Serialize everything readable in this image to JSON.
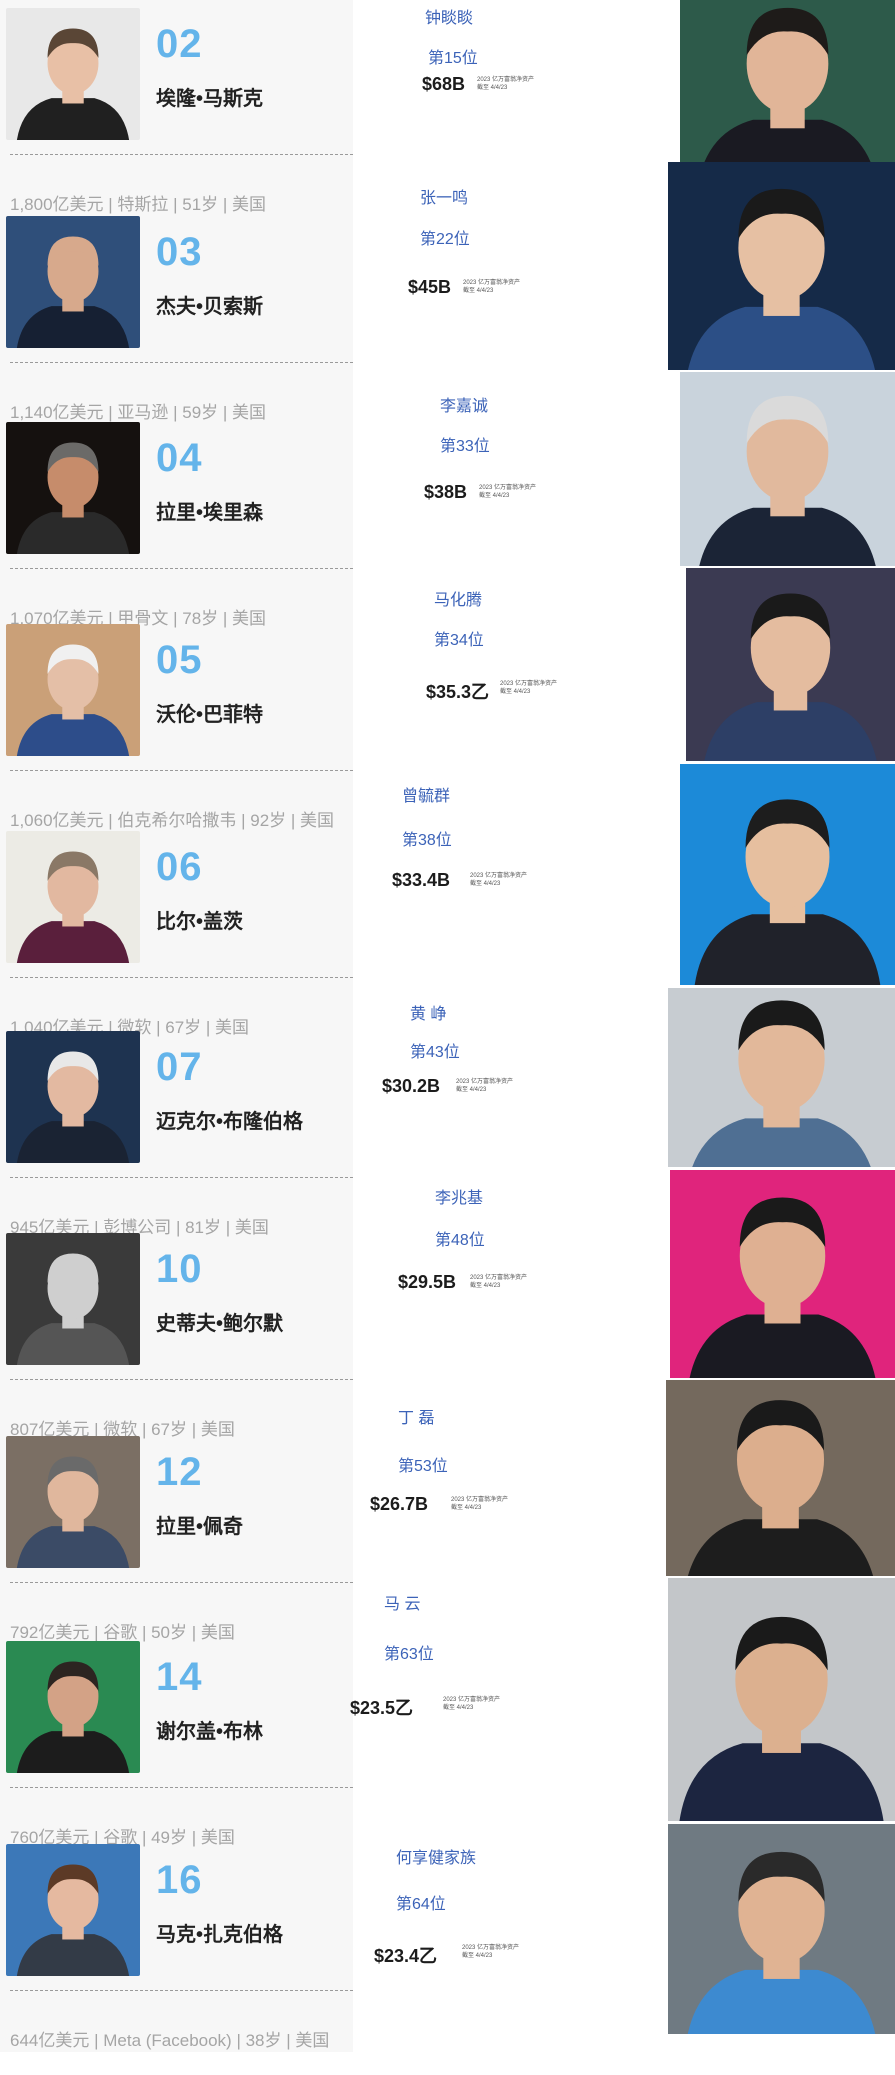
{
  "left_list": [
    {
      "rank": "02",
      "name": "埃隆•马斯克",
      "meta": "1,800亿美元 | 特斯拉 | 51岁 | 美国",
      "bg": "#e8e8e8",
      "skin": "#e8c0a6",
      "hair": "#5a4636",
      "shirt": "#202020"
    },
    {
      "rank": "03",
      "name": "杰夫•贝索斯",
      "meta": "1,140亿美元 | 亚马逊 | 59岁 | 美国",
      "bg": "#2f4f7a",
      "skin": "#d7a98c",
      "hair": "#d7a98c",
      "shirt": "#162033"
    },
    {
      "rank": "04",
      "name": "拉里•埃里森",
      "meta": "1,070亿美元 | 甲骨文 | 78岁 | 美国",
      "bg": "#15110f",
      "skin": "#c68c6b",
      "hair": "#6b6a68",
      "shirt": "#2a2a2a"
    },
    {
      "rank": "05",
      "name": "沃伦•巴菲特",
      "meta": "1,060亿美元 | 伯克希尔哈撒韦 | 92岁 | 美国",
      "bg": "#caa078",
      "skin": "#e4bfa7",
      "hair": "#f0f0f0",
      "shirt": "#2d4d8a"
    },
    {
      "rank": "06",
      "name": "比尔•盖茨",
      "meta": "1,040亿美元 | 微软 | 67岁 | 美国",
      "bg": "#ecebe5",
      "skin": "#e2b8a0",
      "hair": "#8a7866",
      "shirt": "#5a1f3c"
    },
    {
      "rank": "07",
      "name": "迈克尔•布隆伯格",
      "meta": "945亿美元 | 彭博公司 | 81岁 | 美国",
      "bg": "#1e3350",
      "skin": "#e3b9a1",
      "hair": "#e8e8e8",
      "shirt": "#1a2333"
    },
    {
      "rank": "10",
      "name": "史蒂夫•鲍尔默",
      "meta": "807亿美元 | 微软 | 67岁 | 美国",
      "bg": "#3a3a3a",
      "skin": "#cfcfcf",
      "hair": "#cfcfcf",
      "shirt": "#555555"
    },
    {
      "rank": "12",
      "name": "拉里•佩奇",
      "meta": "792亿美元 | 谷歌 | 50岁 | 美国",
      "bg": "#7b6f64",
      "skin": "#e0b79d",
      "hair": "#6a6a6a",
      "shirt": "#3b4b66"
    },
    {
      "rank": "14",
      "name": "谢尔盖•布林",
      "meta": "760亿美元 | 谷歌 | 49岁 | 美国",
      "bg": "#2a8a52",
      "skin": "#d3a286",
      "hair": "#2c2521",
      "shirt": "#1c1c1c"
    },
    {
      "rank": "16",
      "name": "马克•扎克伯格",
      "meta": "644亿美元 | Meta (Facebook) | 38岁 | 美国",
      "bg": "#3c78b8",
      "skin": "#e5b9a0",
      "hair": "#5c3a26",
      "shirt": "#333b47"
    }
  ],
  "right_list": [
    {
      "name": "钟睒睒",
      "rank": "第15位",
      "value": "$68B",
      "caption_1": "2023 亿万富翁净资产",
      "caption_2": "截至 4/4/23",
      "bg": "#2d5a4a",
      "skin": "#e1b598",
      "hair": "#1e1b19",
      "shirt": "#1a1a22"
    },
    {
      "name": "张一鸣",
      "rank": "第22位",
      "value": "$45B",
      "caption_1": "2023 亿万富翁净资产",
      "caption_2": "截至 4/4/23",
      "bg": "#152a48",
      "skin": "#e6c0a3",
      "hair": "#1a1a1a",
      "shirt": "#2c4f86"
    },
    {
      "name": "李嘉诚",
      "rank": "第33位",
      "value": "$38B",
      "caption_1": "2023 亿万富翁净资产",
      "caption_2": "截至 4/4/23",
      "bg": "#c9d3dc",
      "skin": "#e1b99d",
      "hair": "#dadada",
      "shirt": "#1b2436"
    },
    {
      "name": "马化腾",
      "rank": "第34位",
      "value": "$35.3乙",
      "caption_1": "2023 亿万富翁净资产",
      "caption_2": "截至 4/4/23",
      "bg": "#3b3a52",
      "skin": "#e4bc9f",
      "hair": "#1a1a1a",
      "shirt": "#2d3f66"
    },
    {
      "name": "曾毓群",
      "rank": "第38位",
      "value": "$33.4B",
      "caption_1": "2023 亿万富翁净资产",
      "caption_2": "截至 4/4/23",
      "bg": "#1c8ad8",
      "skin": "#e6bf9f",
      "hair": "#1d1d1d",
      "shirt": "#20222a"
    },
    {
      "name": "黄  峥",
      "rank": "第43位",
      "value": "$30.2B",
      "caption_1": "2023 亿万富翁净资产",
      "caption_2": "截至 4/4/23",
      "bg": "#c7ccd1",
      "skin": "#e2b89a",
      "hair": "#1a1a1a",
      "shirt": "#4f6f93"
    },
    {
      "name": "李兆基",
      "rank": "第48位",
      "value": "$29.5B",
      "caption_1": "2023 亿万富翁净资产",
      "caption_2": "截至 4/4/23",
      "bg": "#e0247c",
      "skin": "#dfb092",
      "hair": "#1a1a1a",
      "shirt": "#1a1a22"
    },
    {
      "name": "丁  磊",
      "rank": "第53位",
      "value": "$26.7B",
      "caption_1": "2023 亿万富翁净资产",
      "caption_2": "截至 4/4/23",
      "bg": "#74695d",
      "skin": "#dcae8d",
      "hair": "#1a1a1a",
      "shirt": "#1d1d1d"
    },
    {
      "name": "马  云",
      "rank": "第63位",
      "value": "$23.5乙",
      "caption_1": "2023 亿万富翁净资产",
      "caption_2": "截至 4/4/23",
      "bg": "#c3c6c9",
      "skin": "#dcb08f",
      "hair": "#1a1a1a",
      "shirt": "#1c2540"
    },
    {
      "name": "何享健家族",
      "rank": "第64位",
      "value": "$23.4乙",
      "caption_1": "2023 亿万富翁净资产",
      "caption_2": "截至 4/4/23",
      "bg": "#6f7a82",
      "skin": "#e0b393",
      "hair": "#2a2a2a",
      "shirt": "#3d8ad0"
    }
  ]
}
